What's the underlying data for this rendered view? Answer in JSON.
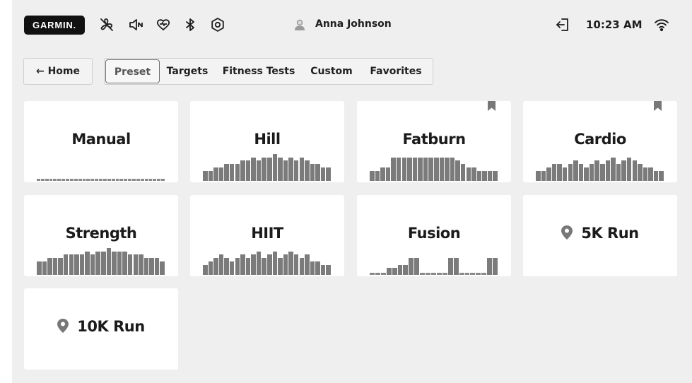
{
  "header": {
    "brand": "GARMIN.",
    "user_name": "Anna Johnson",
    "time": "10:23 AM",
    "icons": [
      "no-fan-icon",
      "volume-icon",
      "heart-icon",
      "bluetooth-icon",
      "settings-icon",
      "user-avatar-icon",
      "logout-icon",
      "wifi-icon"
    ]
  },
  "nav": {
    "home_label": "← Home",
    "tabs": [
      {
        "label": "Preset",
        "active": true
      },
      {
        "label": "Targets",
        "active": false
      },
      {
        "label": "Fitness Tests",
        "active": false
      },
      {
        "label": "Custom",
        "active": false
      },
      {
        "label": "Favorites",
        "active": false
      }
    ]
  },
  "workouts": [
    {
      "name": "Manual",
      "bookmarked": false,
      "location": false,
      "profile": [
        1,
        1,
        1,
        1,
        1,
        1,
        1,
        1,
        1,
        1,
        1,
        1,
        1,
        1,
        1,
        1,
        1,
        1,
        1,
        1,
        1,
        1,
        1,
        1,
        1,
        1,
        1,
        1,
        1,
        1,
        1
      ]
    },
    {
      "name": "Hill",
      "bookmarked": false,
      "location": false,
      "profile": [
        3,
        3,
        4,
        4,
        5,
        5,
        5,
        6,
        6,
        7,
        6,
        7,
        7,
        8,
        7,
        6,
        7,
        6,
        7,
        6,
        5,
        5,
        4,
        4
      ]
    },
    {
      "name": "Fatburn",
      "bookmarked": true,
      "location": false,
      "profile": [
        3,
        3,
        4,
        4,
        7,
        7,
        7,
        7,
        7,
        7,
        7,
        7,
        7,
        7,
        7,
        7,
        6,
        5,
        4,
        4,
        3,
        3,
        3,
        3
      ]
    },
    {
      "name": "Cardio",
      "bookmarked": true,
      "location": false,
      "profile": [
        3,
        3,
        4,
        5,
        5,
        4,
        5,
        6,
        5,
        4,
        5,
        6,
        5,
        6,
        7,
        5,
        6,
        7,
        6,
        5,
        4,
        4,
        3,
        3
      ]
    },
    {
      "name": "Strength",
      "bookmarked": false,
      "location": false,
      "profile": [
        4,
        4,
        5,
        5,
        5,
        6,
        6,
        6,
        6,
        7,
        6,
        7,
        7,
        8,
        7,
        7,
        7,
        6,
        6,
        6,
        5,
        5,
        5,
        4
      ]
    },
    {
      "name": "HIIT",
      "bookmarked": false,
      "location": false,
      "profile": [
        3,
        4,
        5,
        6,
        5,
        4,
        5,
        6,
        5,
        6,
        7,
        5,
        6,
        7,
        5,
        6,
        7,
        6,
        5,
        6,
        4,
        4,
        3,
        3
      ]
    },
    {
      "name": "Fusion",
      "bookmarked": false,
      "location": false,
      "profile": [
        1,
        1,
        1,
        2,
        2,
        3,
        3,
        5,
        5,
        1,
        1,
        1,
        1,
        1,
        5,
        5,
        1,
        1,
        1,
        1,
        1,
        5,
        5
      ]
    },
    {
      "name": "5K Run",
      "bookmarked": false,
      "location": true,
      "profile": []
    },
    {
      "name": "10K Run",
      "bookmarked": false,
      "location": true,
      "profile": []
    }
  ],
  "colors": {
    "background": "#efefef",
    "card": "#ffffff",
    "bar": "#7b7b7b",
    "brand_badge": "#111111"
  }
}
